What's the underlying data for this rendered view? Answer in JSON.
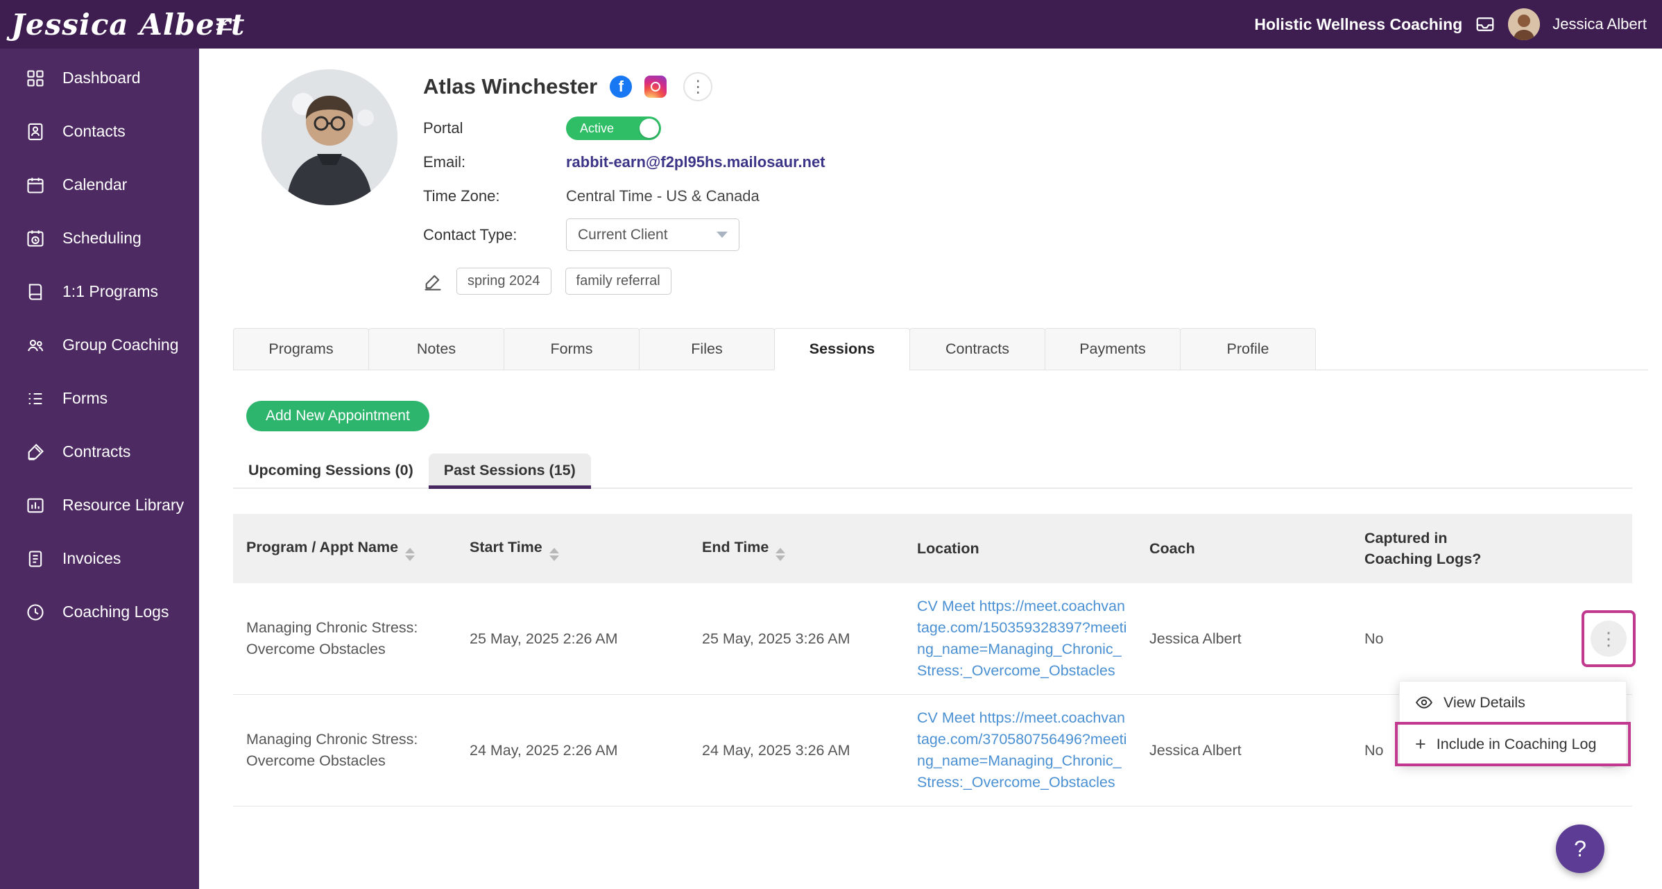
{
  "topbar": {
    "logo": "Jessica Albert",
    "org_name": "Holistic Wellness Coaching",
    "user_name": "Jessica Albert"
  },
  "sidebar": {
    "items": [
      {
        "label": "Dashboard",
        "icon": "dashboard-icon"
      },
      {
        "label": "Contacts",
        "icon": "contacts-icon"
      },
      {
        "label": "Calendar",
        "icon": "calendar-icon"
      },
      {
        "label": "Scheduling",
        "icon": "scheduling-icon"
      },
      {
        "label": "1:1 Programs",
        "icon": "programs-icon"
      },
      {
        "label": "Group Coaching",
        "icon": "group-coaching-icon"
      },
      {
        "label": "Forms",
        "icon": "forms-icon"
      },
      {
        "label": "Contracts",
        "icon": "contracts-icon"
      },
      {
        "label": "Resource Library",
        "icon": "resource-library-icon"
      },
      {
        "label": "Invoices",
        "icon": "invoices-icon"
      },
      {
        "label": "Coaching Logs",
        "icon": "coaching-logs-icon"
      }
    ]
  },
  "profile": {
    "name": "Atlas Winchester",
    "portal_label": "Portal",
    "portal_status": "Active",
    "email_label": "Email:",
    "email": "rabbit-earn@f2pl95hs.mailosaur.net",
    "timezone_label": "Time Zone:",
    "timezone": "Central Time - US & Canada",
    "contact_type_label": "Contact Type:",
    "contact_type": "Current Client",
    "tags": [
      "spring 2024",
      "family referral"
    ]
  },
  "tabs": [
    "Programs",
    "Notes",
    "Forms",
    "Files",
    "Sessions",
    "Contracts",
    "Payments",
    "Profile"
  ],
  "active_tab": "Sessions",
  "sessions": {
    "add_button": "Add New Appointment",
    "subtab_upcoming": "Upcoming Sessions (0)",
    "subtab_past": "Past Sessions (15)",
    "active_subtab": "Past Sessions (15)",
    "table": {
      "columns": [
        "Program / Appt Name",
        "Start Time",
        "End Time",
        "Location",
        "Coach",
        "Captured in Coaching Logs?"
      ],
      "rows": [
        {
          "program": "Managing Chronic Stress: Overcome Obstacles",
          "start": "25 May, 2025 2:26 AM",
          "end": "25 May, 2025 3:26 AM",
          "location_name": "CV Meet",
          "location_url": "https://meet.coachvantage.com/150359328397?meeting_name=Managing_Chronic_Stress:_Overcome_Obstacles",
          "coach": "Jessica Albert",
          "captured": "No"
        },
        {
          "program": "Managing Chronic Stress: Overcome Obstacles",
          "start": "24 May, 2025 2:26 AM",
          "end": "24 May, 2025 3:26 AM",
          "location_name": "CV Meet",
          "location_url": "https://meet.coachvantage.com/370580756496?meeting_name=Managing_Chronic_Stress:_Overcome_Obstacles",
          "coach": "Jessica Albert",
          "captured": "No"
        }
      ]
    },
    "menu": {
      "view_details": "View Details",
      "include_in_log": "Include in Coaching Log"
    }
  },
  "help_label": "?",
  "colors": {
    "topbar_bg": "#3e1d50",
    "sidebar_bg": "#4e2a63",
    "toggle_green": "#2fbe66",
    "button_green": "#2eb56d",
    "link_blue": "#4a90d2",
    "email_purple": "#3c3487",
    "subtab_underline": "#46275f",
    "annotation_magenta": "#c0398e",
    "help_purple": "#5c3c94"
  }
}
